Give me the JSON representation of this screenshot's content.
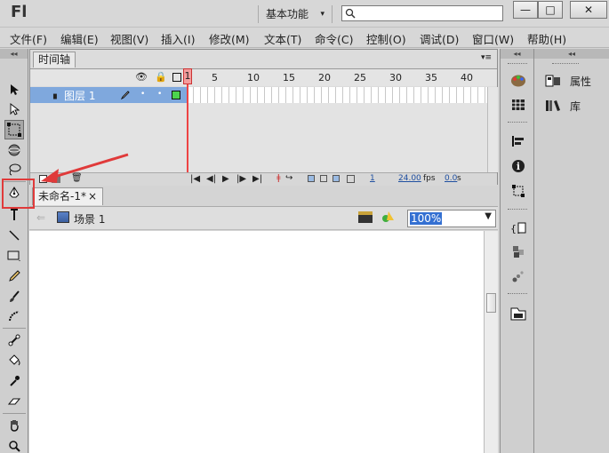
{
  "app": {
    "logo": "Fl",
    "workspace": "基本功能",
    "workspace_arrow": "▾"
  },
  "window_buttons": {
    "minimize": "—",
    "maximize": "□",
    "close": "✕"
  },
  "menu": [
    "文件(F)",
    "编辑(E)",
    "视图(V)",
    "插入(I)",
    "修改(M)",
    "文本(T)",
    "命令(C)",
    "控制(O)",
    "调试(D)",
    "窗口(W)",
    "帮助(H)"
  ],
  "timeline": {
    "tab": "时间轴",
    "ruler": [
      "1",
      "5",
      "10",
      "15",
      "20",
      "25",
      "30",
      "35",
      "40"
    ],
    "layer_name": "图层 1",
    "footer": {
      "frame": "1",
      "fps": "24.00",
      "fps_unit": "fps",
      "time": "0.0",
      "time_unit": "s"
    }
  },
  "document": {
    "tab": "未命名-1*",
    "close": "×",
    "scene": "场景 1",
    "zoom": "100%"
  },
  "dock": {
    "properties": "属性",
    "library": "库"
  },
  "panel_collapse": "◂◂",
  "icons": [
    "arrow-tool-icon",
    "subselection-icon",
    "free-transform-icon",
    "3d-rotation-icon",
    "lasso-icon",
    "pen-icon",
    "text-icon",
    "line-icon",
    "rectangle-icon",
    "pencil-icon",
    "brush-icon",
    "deco-icon",
    "bone-icon",
    "paint-bucket-icon",
    "eyedropper-icon",
    "eraser-icon",
    "hand-icon",
    "zoom-icon"
  ],
  "colors": {
    "layer_row": "#7fa8dd",
    "playhead": "#e44444",
    "highlight_box": "#e03a3a",
    "annotation_arrow": "#e03a3a"
  }
}
